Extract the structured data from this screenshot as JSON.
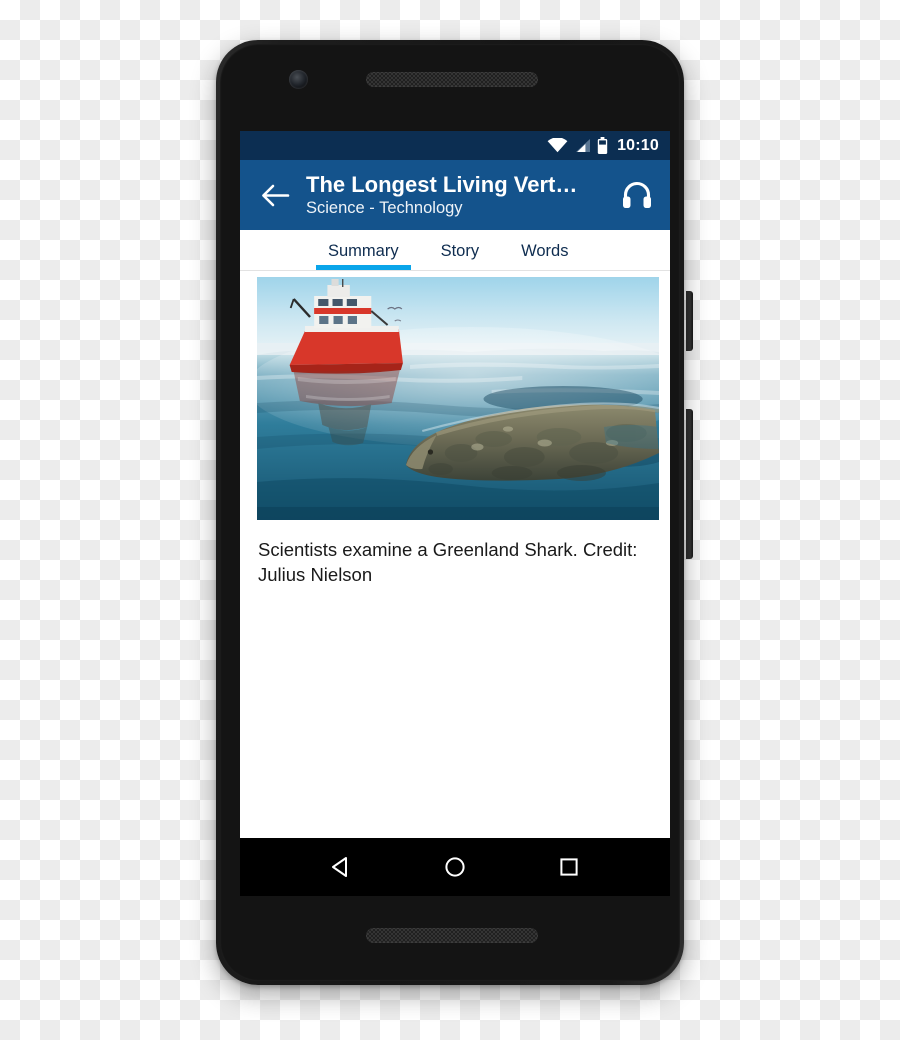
{
  "device": {
    "name": "android-smartphone",
    "front_camera": "front-camera",
    "earpiece": "earpiece-speaker",
    "bottom_speaker": "bottom-speaker",
    "power_button": "power-button",
    "volume_button": "volume-rocker"
  },
  "status_bar": {
    "clock": "10:10",
    "icons": [
      "wifi-icon",
      "signal-icon",
      "battery-icon"
    ],
    "background": "#0c2e52"
  },
  "app_bar": {
    "back_icon": "back-arrow-icon",
    "title": "The Longest Living Vert…",
    "subtitle": "Science - Technology",
    "action_icon": "headphones-icon",
    "background": "#14538c",
    "text_color": "#ffffff"
  },
  "tabs": {
    "active_index": 0,
    "accent": "#0aa5ea",
    "items": [
      {
        "label": "Summary"
      },
      {
        "label": "Story"
      },
      {
        "label": "Words"
      }
    ]
  },
  "content": {
    "image": {
      "name": "greenland-shark-photo",
      "alt": "Red research vessel on calm arctic water with a Greenland shark surfacing in the foreground"
    },
    "caption": "Scientists examine a Greenland Shark. Credit: Julius Nielson"
  },
  "nav_bar": {
    "background": "#000000",
    "keys": [
      {
        "name": "back-nav-key",
        "icon": "triangle-back-icon"
      },
      {
        "name": "home-nav-key",
        "icon": "circle-home-icon"
      },
      {
        "name": "recents-nav-key",
        "icon": "square-recents-icon"
      }
    ]
  }
}
